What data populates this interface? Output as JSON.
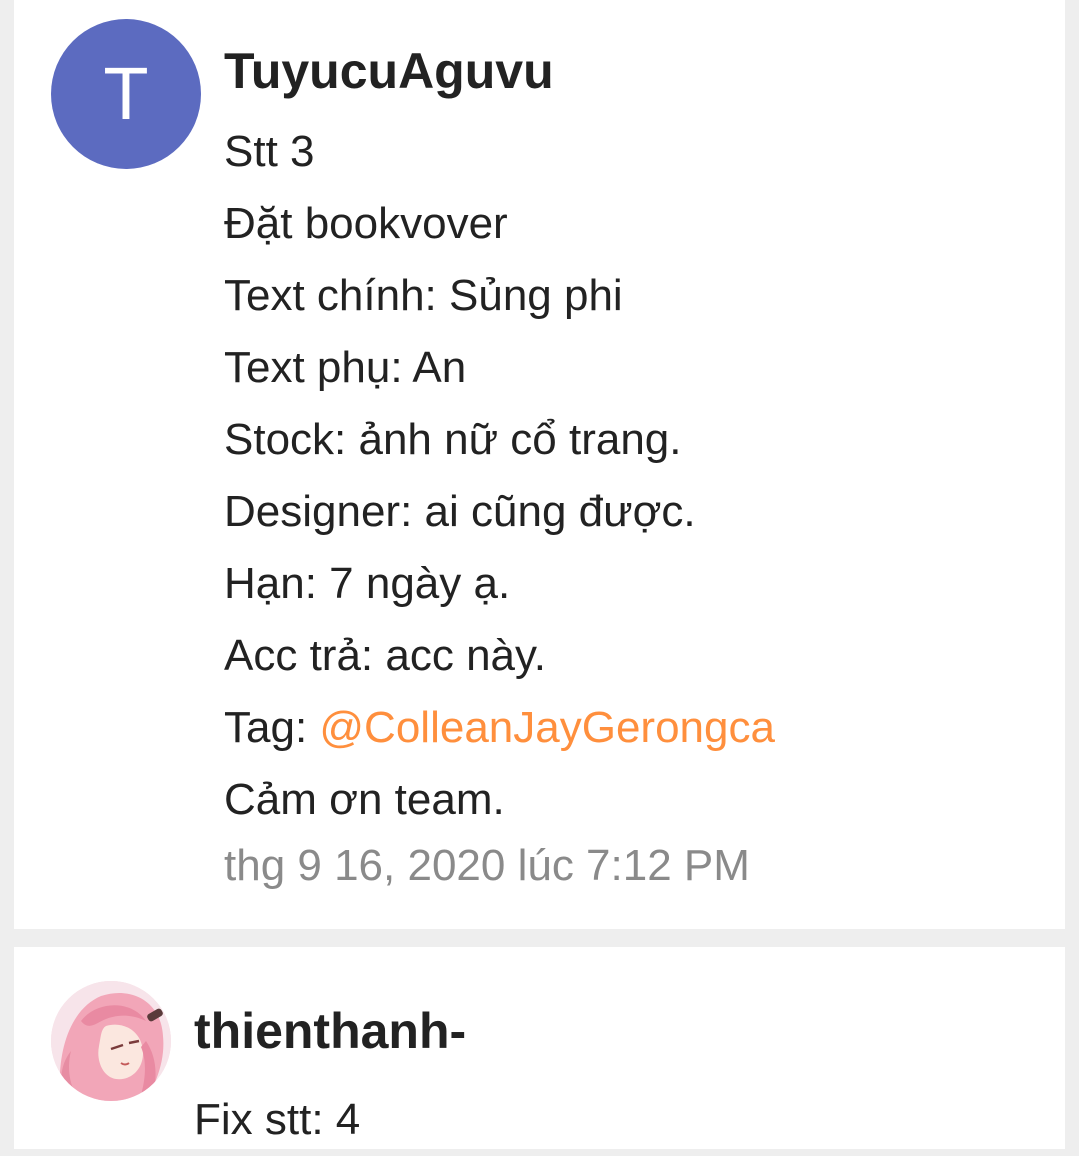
{
  "comments": [
    {
      "avatar_letter": "T",
      "avatar_color": "#5c6bc0",
      "username": "TuyucuAguvu",
      "lines": [
        "Stt 3",
        "Đặt bookvover",
        "Text chính: Sủng phi",
        "Text phụ: An",
        "Stock: ảnh nữ cổ trang.",
        "Designer: ai cũng được.",
        "Hạn: 7 ngày ạ.",
        "Acc trả: acc này."
      ],
      "tag_prefix": "Tag: ",
      "tag_mention": "@ColleanJayGerongca",
      "closing": "Cảm ơn team.",
      "timestamp": "thg 9 16, 2020 lúc 7:12 PM"
    },
    {
      "avatar_icon": "anime-avatar-icon",
      "username": "thienthanh-",
      "lines": [
        "Fix stt: 4"
      ]
    }
  ],
  "colors": {
    "mention": "#ff8f3d",
    "timestamp": "#8a8a8a",
    "background": "#eeeeee",
    "card": "#ffffff"
  }
}
